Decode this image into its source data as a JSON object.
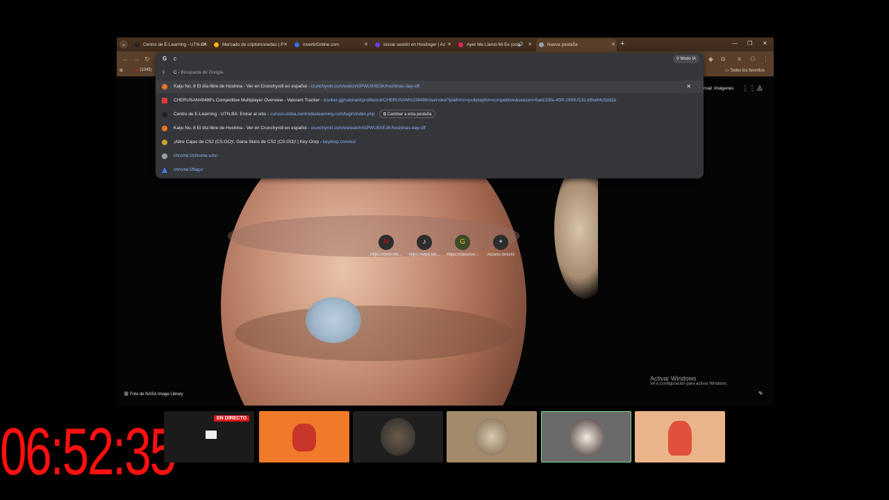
{
  "tabs": [
    {
      "title": "Centro de E-Learning - UTN.BA",
      "fav_color": "#222222"
    },
    {
      "title": "Mercado de criptomonedas | P",
      "fav_color": "#f0b90b"
    },
    {
      "title": "invertirOnline.com",
      "fav_color": "#3a6cf0"
    },
    {
      "title": "Iniciar sesión en Hostinger | Ac",
      "fav_color": "#673de6"
    },
    {
      "title": "Ayer Me Llamó Mi Ex (con",
      "fav_color": "#e0245e"
    },
    {
      "title": "Nueva pestaña",
      "fav_color": "#9aa0a6"
    }
  ],
  "bookmarks": {
    "first": "(1045)",
    "all": "Todos los favoritos"
  },
  "omnibox": {
    "input": "c",
    "ai_mode": "Modo IA",
    "search_row": {
      "letter": "C",
      "text": "Búsqueda de Google"
    },
    "suggestions": [
      {
        "title": "Kaiju No. 8 El día libre de Hoshina - Ver en Crunchyroll en español",
        "url": "crunchyroll.com/watch/GPWU8XE3K/hoshinas-day-off",
        "icon_color": "#f47521"
      },
      {
        "title": "CHERUSAN#9489's Competitive Multiplayer Overview - Valorant Tracker",
        "url": "tracker.gg/valorant/profile/riot/CHERUSAN%239489/overview?platform=pc&playlist=competitive&season=5adc33fa-4f30-2899-f131-6fba64c5dd3a",
        "icon_color": "#e03a3a"
      },
      {
        "title": "Centro de E-Learning - UTN.BA: Entrar al sitio",
        "url": "cursos.utnba.centrodeelearning.com/login/index.php",
        "icon_color": "#222222",
        "switch": "Cambiar a esta pestaña"
      },
      {
        "title": "Kaiju No. 8 El día libre de Hoshina - Ver en Crunchyroll en español",
        "url": "crunchyroll.com/es/watch/GPWU8XE3K/hoshinas-day-off",
        "icon_color": "#f47521"
      },
      {
        "title": "¡Abre Cajas de CS2 (CS:GO)!, Gana Skins de CS2 (CS:GO)! | Key-Drop",
        "url": "keydrop.com/es/",
        "icon_color": "#c9a227"
      },
      {
        "title": "",
        "url": "chrome://chrome-urls/",
        "icon_color": "#9aa0a6"
      },
      {
        "title": "",
        "url": "chrome://flags/",
        "icon_color": "#4a7cf0"
      }
    ]
  },
  "page": {
    "gmail": "Gmail",
    "images": "Imágenes",
    "shortcuts": [
      {
        "label": "https://www.net...",
        "glyph": "N",
        "color": "#e50914"
      },
      {
        "label": "https://www.tikt...",
        "glyph": "♪",
        "color": "#ffffff"
      },
      {
        "label": "https://classroo...",
        "glyph": "G",
        "color": "#1e8e3e"
      },
      {
        "label": "Acceso directo",
        "glyph": "+",
        "color": "#e8eaed"
      }
    ],
    "photo_credit": "Foto de NASA Image Library",
    "activate_title": "Activar Windows",
    "activate_sub": "Ve a Configuración para activar Windows."
  },
  "overlay": {
    "timer": "06:52:35",
    "live": "EN DIRECTO"
  }
}
